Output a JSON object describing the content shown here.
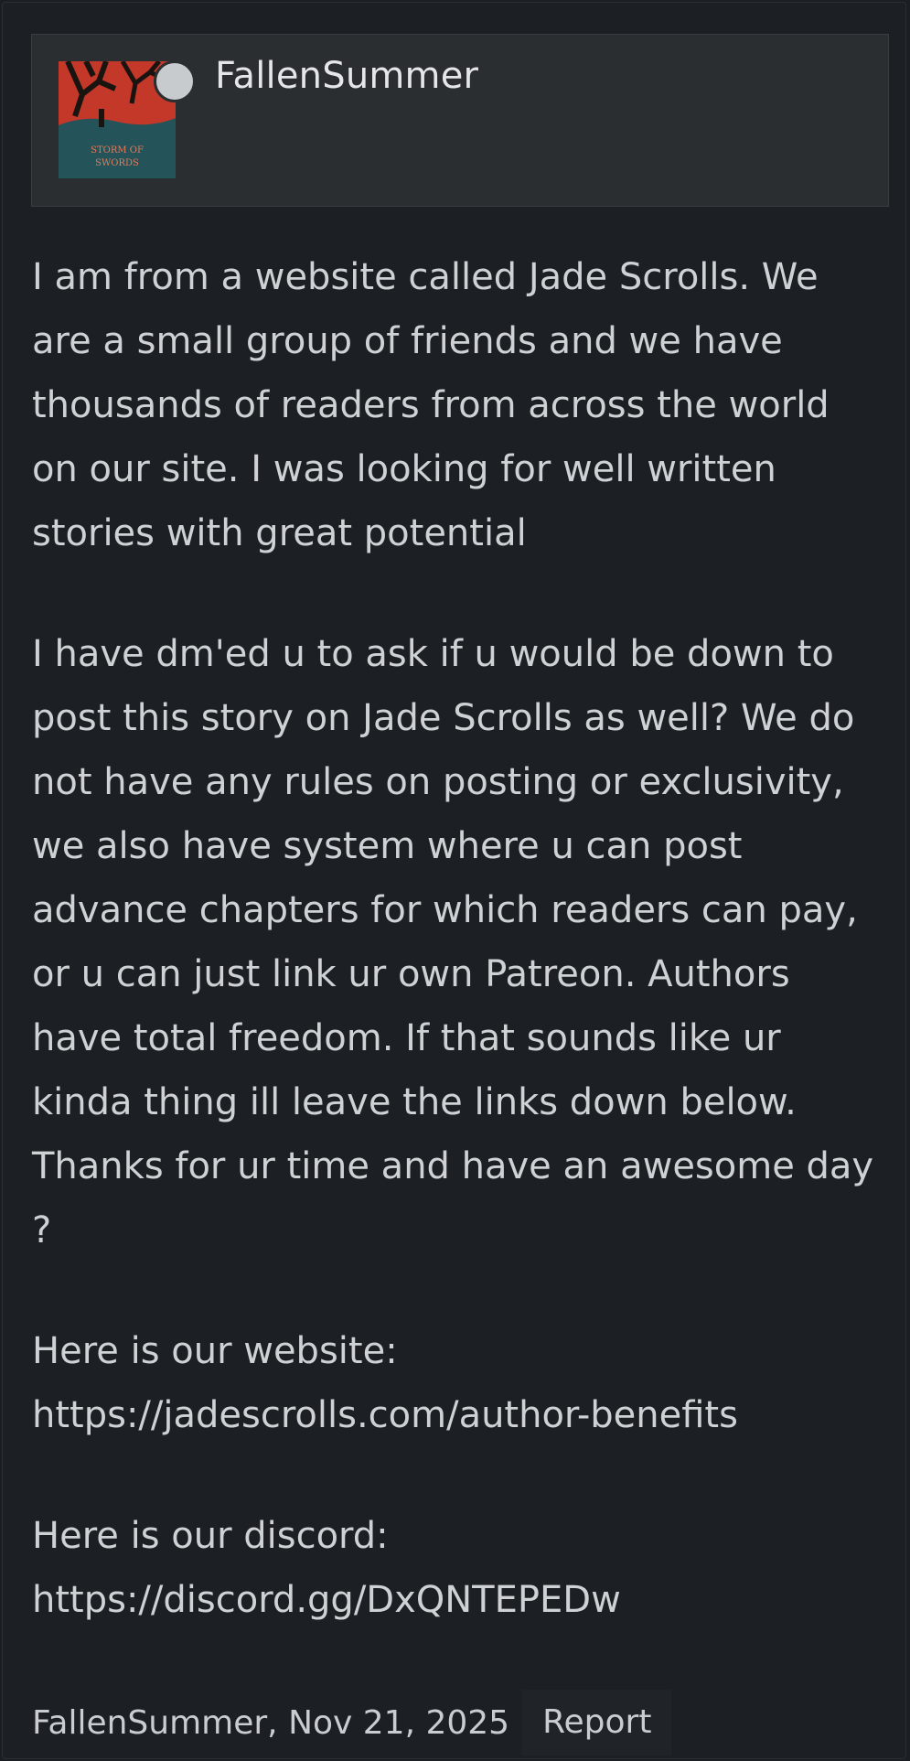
{
  "post": {
    "username": "FallenSummer",
    "avatar": {
      "icon": "book-cover-avatar",
      "cover_text": "A STORM OF SWORDS"
    },
    "status_color": "#c8cbce",
    "body": {
      "paragraph_1": "I am from a website called Jade Scrolls. We\nare a small group of friends and we have\nthousands of readers from across the world\non our site. I was looking for well written\nstories with great potential",
      "paragraph_2": "I have dm'ed u to ask if u would be down to\npost this story on Jade Scrolls as well? We do\nnot have any rules on posting or exclusivity,\nwe also have system where u can post\nadvance chapters for which readers can pay,\nor u can just link ur own Patreon. Authors\nhave total freedom. If that sounds like ur\nkinda thing ill leave the links down below.\nThanks for ur time and have an awesome day\n?",
      "website_label": "Here is our website:",
      "website_link": "https://jadescrolls.com/author-benefits",
      "discord_label": "Here is our discord:",
      "discord_link": "https://discord.gg/DxQNTEPEDw"
    },
    "footer": {
      "meta": "FallenSummer, Nov 21, 2025",
      "report_label": "Report"
    }
  }
}
